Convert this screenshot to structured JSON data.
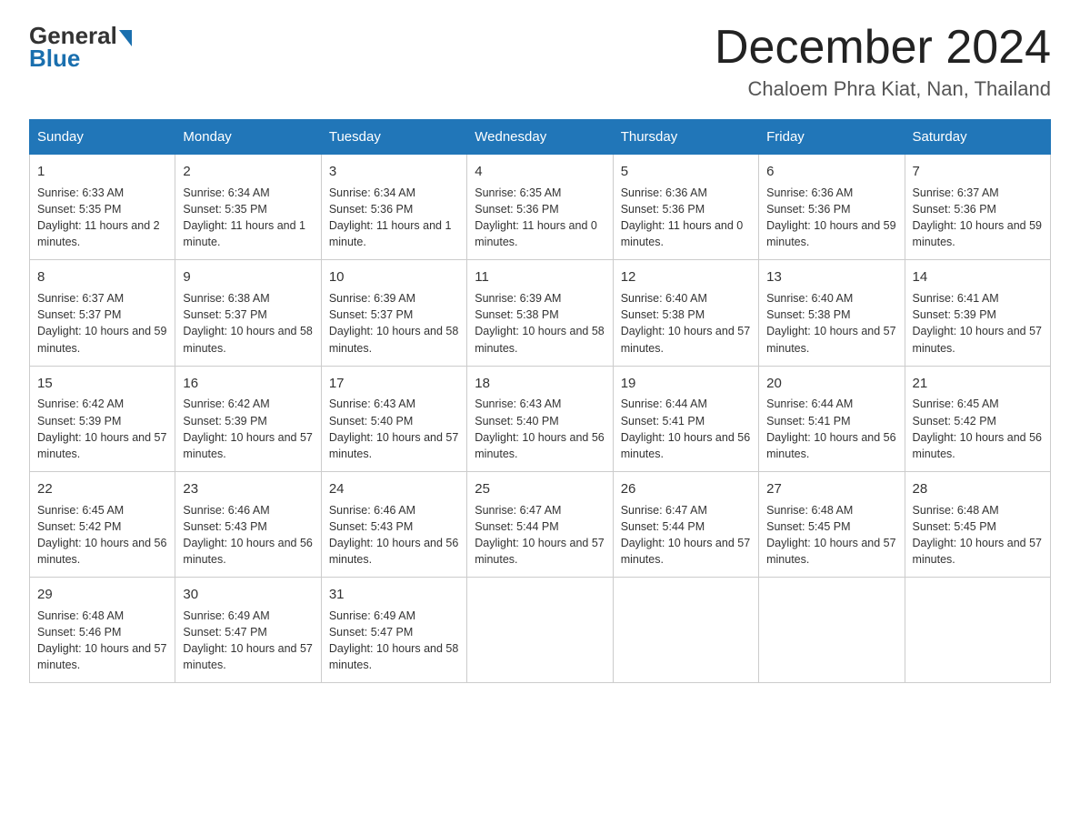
{
  "logo": {
    "general": "General",
    "blue": "Blue"
  },
  "title": "December 2024",
  "location": "Chaloem Phra Kiat, Nan, Thailand",
  "days_of_week": [
    "Sunday",
    "Monday",
    "Tuesday",
    "Wednesday",
    "Thursday",
    "Friday",
    "Saturday"
  ],
  "weeks": [
    [
      {
        "day": "1",
        "sunrise": "6:33 AM",
        "sunset": "5:35 PM",
        "daylight": "11 hours and 2 minutes."
      },
      {
        "day": "2",
        "sunrise": "6:34 AM",
        "sunset": "5:35 PM",
        "daylight": "11 hours and 1 minute."
      },
      {
        "day": "3",
        "sunrise": "6:34 AM",
        "sunset": "5:36 PM",
        "daylight": "11 hours and 1 minute."
      },
      {
        "day": "4",
        "sunrise": "6:35 AM",
        "sunset": "5:36 PM",
        "daylight": "11 hours and 0 minutes."
      },
      {
        "day": "5",
        "sunrise": "6:36 AM",
        "sunset": "5:36 PM",
        "daylight": "11 hours and 0 minutes."
      },
      {
        "day": "6",
        "sunrise": "6:36 AM",
        "sunset": "5:36 PM",
        "daylight": "10 hours and 59 minutes."
      },
      {
        "day": "7",
        "sunrise": "6:37 AM",
        "sunset": "5:36 PM",
        "daylight": "10 hours and 59 minutes."
      }
    ],
    [
      {
        "day": "8",
        "sunrise": "6:37 AM",
        "sunset": "5:37 PM",
        "daylight": "10 hours and 59 minutes."
      },
      {
        "day": "9",
        "sunrise": "6:38 AM",
        "sunset": "5:37 PM",
        "daylight": "10 hours and 58 minutes."
      },
      {
        "day": "10",
        "sunrise": "6:39 AM",
        "sunset": "5:37 PM",
        "daylight": "10 hours and 58 minutes."
      },
      {
        "day": "11",
        "sunrise": "6:39 AM",
        "sunset": "5:38 PM",
        "daylight": "10 hours and 58 minutes."
      },
      {
        "day": "12",
        "sunrise": "6:40 AM",
        "sunset": "5:38 PM",
        "daylight": "10 hours and 57 minutes."
      },
      {
        "day": "13",
        "sunrise": "6:40 AM",
        "sunset": "5:38 PM",
        "daylight": "10 hours and 57 minutes."
      },
      {
        "day": "14",
        "sunrise": "6:41 AM",
        "sunset": "5:39 PM",
        "daylight": "10 hours and 57 minutes."
      }
    ],
    [
      {
        "day": "15",
        "sunrise": "6:42 AM",
        "sunset": "5:39 PM",
        "daylight": "10 hours and 57 minutes."
      },
      {
        "day": "16",
        "sunrise": "6:42 AM",
        "sunset": "5:39 PM",
        "daylight": "10 hours and 57 minutes."
      },
      {
        "day": "17",
        "sunrise": "6:43 AM",
        "sunset": "5:40 PM",
        "daylight": "10 hours and 57 minutes."
      },
      {
        "day": "18",
        "sunrise": "6:43 AM",
        "sunset": "5:40 PM",
        "daylight": "10 hours and 56 minutes."
      },
      {
        "day": "19",
        "sunrise": "6:44 AM",
        "sunset": "5:41 PM",
        "daylight": "10 hours and 56 minutes."
      },
      {
        "day": "20",
        "sunrise": "6:44 AM",
        "sunset": "5:41 PM",
        "daylight": "10 hours and 56 minutes."
      },
      {
        "day": "21",
        "sunrise": "6:45 AM",
        "sunset": "5:42 PM",
        "daylight": "10 hours and 56 minutes."
      }
    ],
    [
      {
        "day": "22",
        "sunrise": "6:45 AM",
        "sunset": "5:42 PM",
        "daylight": "10 hours and 56 minutes."
      },
      {
        "day": "23",
        "sunrise": "6:46 AM",
        "sunset": "5:43 PM",
        "daylight": "10 hours and 56 minutes."
      },
      {
        "day": "24",
        "sunrise": "6:46 AM",
        "sunset": "5:43 PM",
        "daylight": "10 hours and 56 minutes."
      },
      {
        "day": "25",
        "sunrise": "6:47 AM",
        "sunset": "5:44 PM",
        "daylight": "10 hours and 57 minutes."
      },
      {
        "day": "26",
        "sunrise": "6:47 AM",
        "sunset": "5:44 PM",
        "daylight": "10 hours and 57 minutes."
      },
      {
        "day": "27",
        "sunrise": "6:48 AM",
        "sunset": "5:45 PM",
        "daylight": "10 hours and 57 minutes."
      },
      {
        "day": "28",
        "sunrise": "6:48 AM",
        "sunset": "5:45 PM",
        "daylight": "10 hours and 57 minutes."
      }
    ],
    [
      {
        "day": "29",
        "sunrise": "6:48 AM",
        "sunset": "5:46 PM",
        "daylight": "10 hours and 57 minutes."
      },
      {
        "day": "30",
        "sunrise": "6:49 AM",
        "sunset": "5:47 PM",
        "daylight": "10 hours and 57 minutes."
      },
      {
        "day": "31",
        "sunrise": "6:49 AM",
        "sunset": "5:47 PM",
        "daylight": "10 hours and 58 minutes."
      },
      null,
      null,
      null,
      null
    ]
  ]
}
